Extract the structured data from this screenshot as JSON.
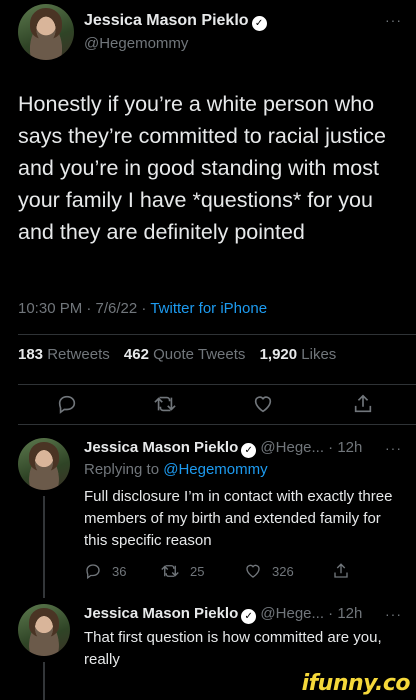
{
  "main_tweet": {
    "name": "Jessica Mason Pieklo",
    "handle": "@Hegemommy",
    "text": "Honestly if you’re a white person who says they’re committed to racial justice and you’re in good standing with most your family I have *questions* for you and they are definitely pointed",
    "time_date": "10:30 PM · 7/6/22 · ",
    "source": "Twitter for iPhone",
    "stats": {
      "retweets_count": "183",
      "retweets_label": "Retweets",
      "quotes_count": "462",
      "quotes_label": "Quote Tweets",
      "likes_count": "1,920",
      "likes_label": "Likes"
    }
  },
  "replies": [
    {
      "name": "Jessica Mason Pieklo",
      "handle_time": "@Hege... · 12h",
      "replying_prefix": "Replying to ",
      "replying_to": "@Hegemommy",
      "text": "Full disclosure I’m in contact with exactly three members of my birth and extended family for this specific reason",
      "replies": "36",
      "retweets": "25",
      "likes": "326"
    },
    {
      "name": "Jessica Mason Pieklo",
      "handle_time": "@Hege... · 12h",
      "text": "That first question is how committed are you, really"
    }
  ],
  "more_glyph": "···",
  "verified_glyph": "✓",
  "watermark": "ifunny.co",
  "icons": [
    "reply-icon",
    "retweet-icon",
    "like-icon",
    "share-icon",
    "verified-badge-icon",
    "more-icon"
  ],
  "colors": {
    "background": "#000000",
    "text": "#e7e9ea",
    "muted": "#71767b",
    "link": "#1d9bf0",
    "watermark": "#f5d83a"
  }
}
